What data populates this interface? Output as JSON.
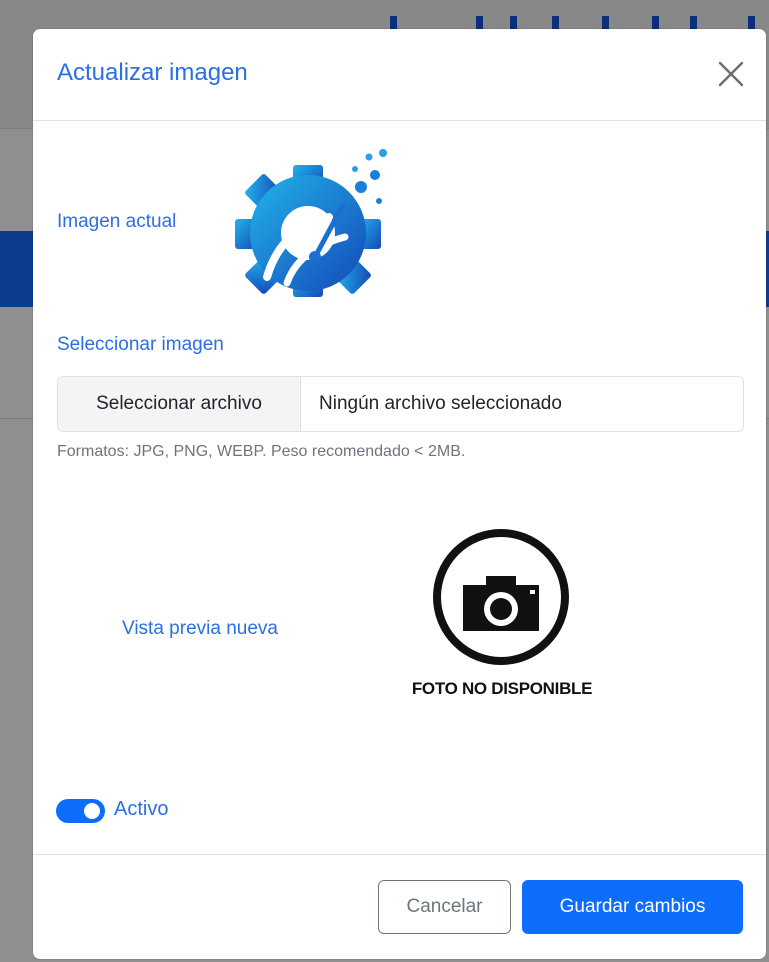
{
  "modal": {
    "title": "Actualizar imagen",
    "current_image_label": "Imagen actual",
    "select_image_label": "Seleccionar imagen",
    "file_input": {
      "button_label": "Seleccionar archivo",
      "status_text": "Ningún archivo seleccionado"
    },
    "help_text": "Formatos: JPG, PNG, WEBP. Peso recomendado < 2MB.",
    "preview": {
      "label": "Vista previa nueva",
      "placeholder_caption": "FOTO NO DISPONIBLE"
    },
    "active_toggle": {
      "label": "Activo",
      "checked": true
    },
    "footer": {
      "cancel_label": "Cancelar",
      "save_label": "Guardar cambios"
    }
  },
  "icons": {
    "close": "close-icon",
    "current_logo": "gear-logo-icon",
    "preview_placeholder": "camera-icon"
  },
  "colors": {
    "title_blue": "#2b6fe2",
    "primary": "#0d6efd",
    "secondary": "#6c757d",
    "logo_gradient_start": "#22b4ea",
    "logo_gradient_end": "#1548b8"
  }
}
